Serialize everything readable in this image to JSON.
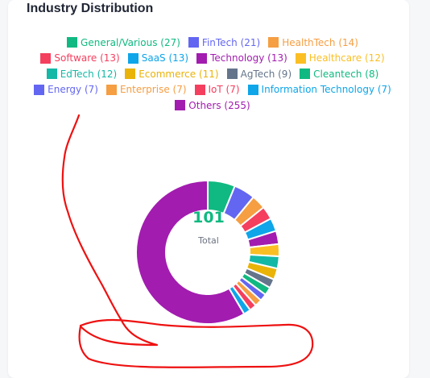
{
  "widget": {
    "title": "Industry Distribution",
    "center_value": "101",
    "center_label": "Total"
  },
  "chart_data": {
    "type": "pie",
    "variant": "donut",
    "title": "Industry Distribution",
    "legend_position": "top",
    "categories": [
      "General/Various",
      "FinTech",
      "HealthTech",
      "Software",
      "SaaS",
      "Technology",
      "Healthcare",
      "EdTech",
      "Ecommerce",
      "AgTech",
      "Cleantech",
      "Energy",
      "Enterprise",
      "IoT",
      "Information Technology",
      "Others"
    ],
    "values": [
      27,
      21,
      14,
      13,
      13,
      13,
      12,
      12,
      11,
      9,
      8,
      7,
      7,
      7,
      7,
      255
    ],
    "colors": [
      "#10b981",
      "#6366f1",
      "#f59e42",
      "#f43f5e",
      "#0ea5e9",
      "#a21caf",
      "#fbbf24",
      "#14b8a6",
      "#eab308",
      "#64748b",
      "#10b981",
      "#6366f1",
      "#f59e42",
      "#f43f5e",
      "#0ea5e9",
      "#a21caf"
    ],
    "legend": [
      [
        "General/Various (27)",
        "FinTech (21)",
        "HealthTech (14)"
      ],
      [
        "Software (13)",
        "SaaS (13)",
        "Technology (13)",
        "Healthcare (12)"
      ],
      [
        "EdTech (12)",
        "Ecommerce (11)",
        "AgTech (9)",
        "Cleantech (8)"
      ],
      [
        "Energy (7)",
        "Enterprise (7)",
        "IoT (7)",
        "Information Technology (7)"
      ],
      [
        "Others (255)"
      ]
    ]
  }
}
